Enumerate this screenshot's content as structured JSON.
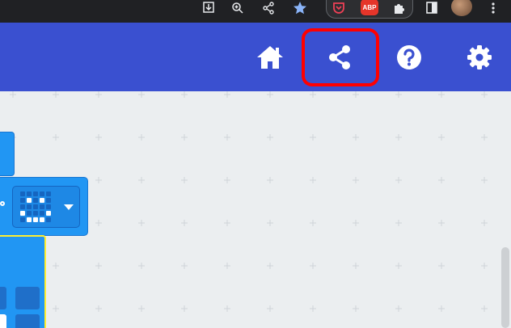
{
  "browser": {
    "toolbar_icons": [
      "install-icon",
      "zoom-icon",
      "share-icon",
      "bookmark-star-icon"
    ],
    "extensions": [
      "pocket-icon",
      "adblock-icon",
      "puzzle-icon",
      "sidepanel-icon"
    ],
    "abp_label": "ABP",
    "menu_icon": "more-vert-icon"
  },
  "header": {
    "buttons": [
      "home-icon",
      "share-icon",
      "help-icon",
      "settings-icon"
    ],
    "highlighted_button": "share",
    "highlight_color": "#ff0000",
    "background": "#3a50d0"
  },
  "workspace": {
    "background": "#ebeef0",
    "blocks": [
      {
        "name": "block-top"
      },
      {
        "name": "led-image-block",
        "dropdown_icon": "caret-down-icon"
      },
      {
        "name": "selected-led-block",
        "selected": true
      }
    ]
  }
}
